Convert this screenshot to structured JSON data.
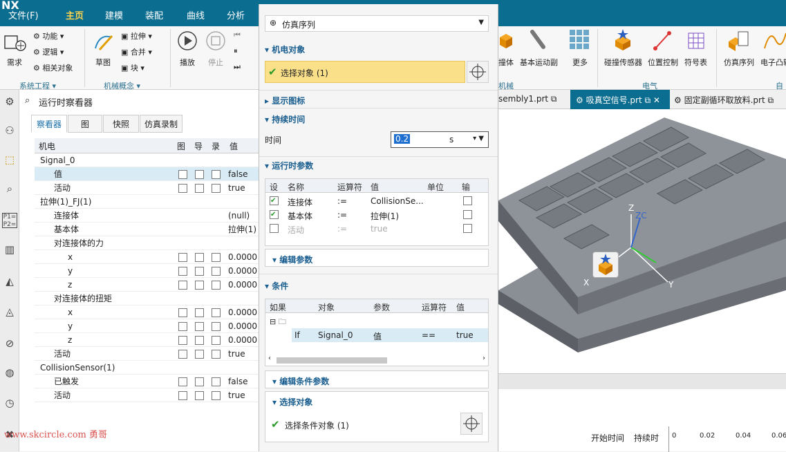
{
  "app": {
    "logo": "NX"
  },
  "menu": [
    "文件(F)",
    "主页",
    "建模",
    "装配",
    "曲线",
    "分析"
  ],
  "ribbon": {
    "syseng": [
      "功能",
      "逻辑",
      "相关对象"
    ],
    "req": "需求",
    "sketch": "草图",
    "mech": [
      "拉伸",
      "合并",
      "块"
    ],
    "play": "播放",
    "stop": "停止",
    "right_items": [
      "撞体",
      "基本运动副",
      "更多",
      "碰撞传感器",
      "位置控制",
      "符号表",
      "仿真序列",
      "电子凸轮"
    ],
    "groups": {
      "syseng": "系统工程",
      "mechconcept": "机械概念",
      "mech": "机械",
      "elec": "电气",
      "auto": "自动"
    }
  },
  "inspector": {
    "title": "运行时察看器",
    "tabs": [
      "察看器",
      "图",
      "快照",
      "仿真录制"
    ],
    "columns": [
      "机电",
      "图",
      "导",
      "录",
      "值"
    ],
    "rows": [
      {
        "label": "Signal_0",
        "value": "",
        "indent": 0,
        "checks": false
      },
      {
        "label": "值",
        "value": "false",
        "indent": 1,
        "checks": true,
        "selected": true
      },
      {
        "label": "活动",
        "value": "true",
        "indent": 1,
        "checks": true
      },
      {
        "label": "拉伸(1)_FJ(1)",
        "value": "",
        "indent": 0,
        "checks": false
      },
      {
        "label": "连接体",
        "value": "(null)",
        "indent": 1,
        "checks": false
      },
      {
        "label": "基本体",
        "value": "拉伸(1)",
        "indent": 1,
        "checks": false
      },
      {
        "label": "对连接体的力",
        "value": "",
        "indent": 1,
        "checks": false
      },
      {
        "label": "x",
        "value": "0.0000",
        "indent": 2,
        "checks": true
      },
      {
        "label": "y",
        "value": "0.0000",
        "indent": 2,
        "checks": true
      },
      {
        "label": "z",
        "value": "0.0000",
        "indent": 2,
        "checks": true
      },
      {
        "label": "对连接体的扭矩",
        "value": "",
        "indent": 1,
        "checks": false
      },
      {
        "label": "x",
        "value": "0.0000",
        "indent": 2,
        "checks": true
      },
      {
        "label": "y",
        "value": "0.0000",
        "indent": 2,
        "checks": true
      },
      {
        "label": "z",
        "value": "0.0000",
        "indent": 2,
        "checks": true
      },
      {
        "label": "活动",
        "value": "true",
        "indent": 1,
        "checks": true
      },
      {
        "label": "CollisionSensor(1)",
        "value": "",
        "indent": 0,
        "checks": false
      },
      {
        "label": "已触发",
        "value": "false",
        "indent": 1,
        "checks": true
      },
      {
        "label": "活动",
        "value": "true",
        "indent": 1,
        "checks": true
      }
    ]
  },
  "dialog": {
    "type_select": "仿真序列",
    "sec_mech": "机电对象",
    "select_obj": "选择对象 (1)",
    "sec_icon": "显示图标",
    "sec_duration": "持续时间",
    "time_label": "时间",
    "time_value": "0.2",
    "time_unit": "s",
    "sec_runtime": "运行时参数",
    "rt_columns": [
      "设",
      "名称",
      "运算符",
      "值",
      "单位",
      "输"
    ],
    "rt_rows": [
      {
        "name": "连接体",
        "op": ":=",
        "value": "CollisionSe...",
        "checked": true,
        "dim": false
      },
      {
        "name": "基本体",
        "op": ":=",
        "value": "拉伸(1)",
        "checked": true,
        "dim": false
      },
      {
        "name": "活动",
        "op": ":=",
        "value": "true",
        "checked": false,
        "dim": true
      }
    ],
    "edit_params": "编辑参数",
    "sec_cond": "条件",
    "cond_columns": [
      "如果",
      "对象",
      "参数",
      "运算符",
      "值"
    ],
    "cond_row": {
      "if": "If",
      "object": "Signal_0",
      "param": "值",
      "op": "==",
      "value": "true"
    },
    "edit_cond": "编辑条件参数",
    "sec_sel": "选择对象",
    "select_cond": "选择条件对象 (1)"
  },
  "viewport": {
    "tabs": [
      "sembly1.prt",
      "吸真空信号.prt",
      "固定副循环取放料.prt"
    ],
    "axis_x": "X",
    "axis_y": "Y",
    "axis_z": "Z",
    "axis_zc": "ZC"
  },
  "timeline": {
    "start_col": "开始时间",
    "dur_col": "持续时",
    "ticks": [
      "0",
      "0.02",
      "0.04",
      "0.06"
    ]
  },
  "watermark": "www.skcircle.com 勇哥"
}
